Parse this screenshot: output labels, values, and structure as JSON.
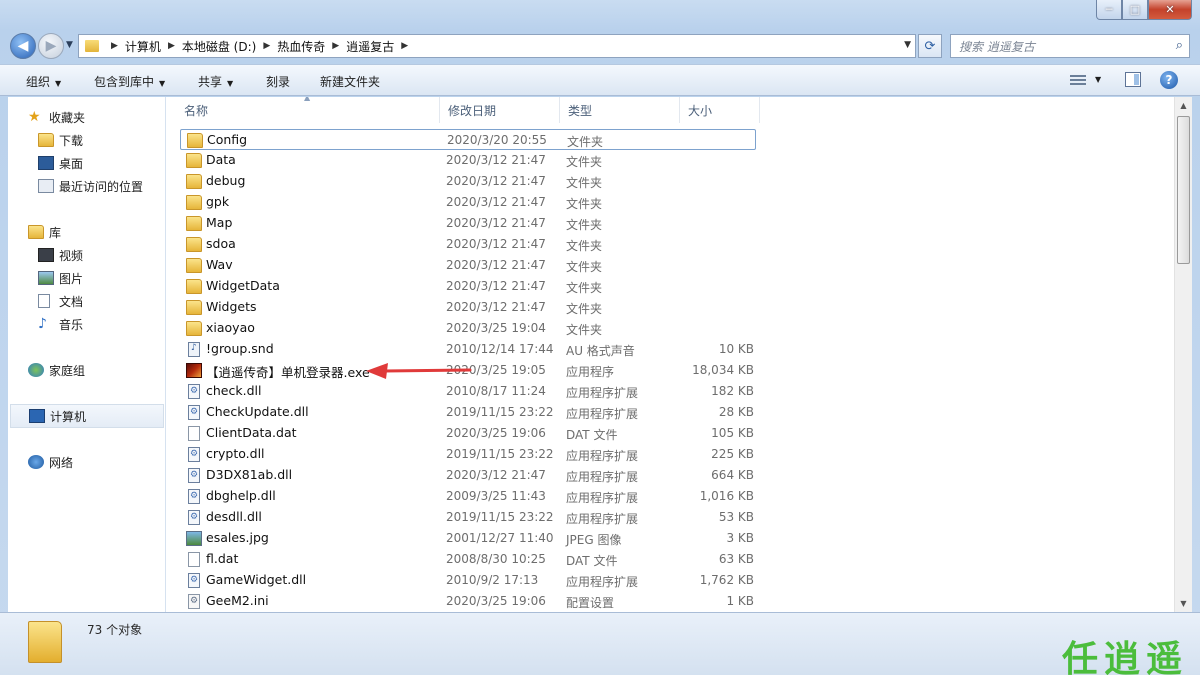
{
  "window": {
    "min": "─",
    "max": "□",
    "close": "✕"
  },
  "address": {
    "crumbs": [
      "计算机",
      "本地磁盘 (D:)",
      "热血传奇",
      "逍遥复古"
    ],
    "search_placeholder": "搜索 逍遥复古"
  },
  "toolbar": {
    "organize": "组织",
    "include_library": "包含到库中",
    "share": "共享",
    "burn": "刻录",
    "new_folder": "新建文件夹"
  },
  "sidebar": {
    "favorites": "收藏夹",
    "downloads": "下载",
    "desktop": "桌面",
    "recent": "最近访问的位置",
    "libraries": "库",
    "videos": "视频",
    "pictures": "图片",
    "documents": "文档",
    "music": "音乐",
    "homegroup": "家庭组",
    "computer": "计算机",
    "network": "网络"
  },
  "columns": {
    "name": "名称",
    "modified": "修改日期",
    "type": "类型",
    "size": "大小"
  },
  "files": [
    {
      "name": "Config",
      "date": "2020/3/20 20:55",
      "type": "文件夹",
      "size": "",
      "icon": "folder"
    },
    {
      "name": "Data",
      "date": "2020/3/12 21:47",
      "type": "文件夹",
      "size": "",
      "icon": "folder"
    },
    {
      "name": "debug",
      "date": "2020/3/12 21:47",
      "type": "文件夹",
      "size": "",
      "icon": "folder"
    },
    {
      "name": "gpk",
      "date": "2020/3/12 21:47",
      "type": "文件夹",
      "size": "",
      "icon": "folder"
    },
    {
      "name": "Map",
      "date": "2020/3/12 21:47",
      "type": "文件夹",
      "size": "",
      "icon": "folder"
    },
    {
      "name": "sdoa",
      "date": "2020/3/12 21:47",
      "type": "文件夹",
      "size": "",
      "icon": "folder"
    },
    {
      "name": "Wav",
      "date": "2020/3/12 21:47",
      "type": "文件夹",
      "size": "",
      "icon": "folder"
    },
    {
      "name": "WidgetData",
      "date": "2020/3/12 21:47",
      "type": "文件夹",
      "size": "",
      "icon": "folder"
    },
    {
      "name": "Widgets",
      "date": "2020/3/12 21:47",
      "type": "文件夹",
      "size": "",
      "icon": "folder"
    },
    {
      "name": "xiaoyao",
      "date": "2020/3/25 19:04",
      "type": "文件夹",
      "size": "",
      "icon": "folder"
    },
    {
      "name": "!group.snd",
      "date": "2010/12/14 17:44",
      "type": "AU 格式声音",
      "size": "10 KB",
      "icon": "snd"
    },
    {
      "name": "【逍遥传奇】单机登录器.exe",
      "date": "2020/3/25 19:05",
      "type": "应用程序",
      "size": "18,034 KB",
      "icon": "exe"
    },
    {
      "name": "check.dll",
      "date": "2010/8/17 11:24",
      "type": "应用程序扩展",
      "size": "182 KB",
      "icon": "dll"
    },
    {
      "name": "CheckUpdate.dll",
      "date": "2019/11/15 23:22",
      "type": "应用程序扩展",
      "size": "28 KB",
      "icon": "dll"
    },
    {
      "name": "ClientData.dat",
      "date": "2020/3/25 19:06",
      "type": "DAT 文件",
      "size": "105 KB",
      "icon": "file"
    },
    {
      "name": "crypto.dll",
      "date": "2019/11/15 23:22",
      "type": "应用程序扩展",
      "size": "225 KB",
      "icon": "dll"
    },
    {
      "name": "D3DX81ab.dll",
      "date": "2020/3/12 21:47",
      "type": "应用程序扩展",
      "size": "664 KB",
      "icon": "dll"
    },
    {
      "name": "dbghelp.dll",
      "date": "2009/3/25 11:43",
      "type": "应用程序扩展",
      "size": "1,016 KB",
      "icon": "dll"
    },
    {
      "name": "desdll.dll",
      "date": "2019/11/15 23:22",
      "type": "应用程序扩展",
      "size": "53 KB",
      "icon": "dll"
    },
    {
      "name": "esales.jpg",
      "date": "2001/12/27 11:40",
      "type": "JPEG 图像",
      "size": "3 KB",
      "icon": "img"
    },
    {
      "name": "fl.dat",
      "date": "2008/8/30 10:25",
      "type": "DAT 文件",
      "size": "63 KB",
      "icon": "file"
    },
    {
      "name": "GameWidget.dll",
      "date": "2010/9/2 17:13",
      "type": "应用程序扩展",
      "size": "1,762 KB",
      "icon": "dll"
    },
    {
      "name": "GeeM2.ini",
      "date": "2020/3/25 19:06",
      "type": "配置设置",
      "size": "1 KB",
      "icon": "ini"
    }
  ],
  "status": {
    "count": "73 个对象"
  },
  "watermark": "任逍遥"
}
